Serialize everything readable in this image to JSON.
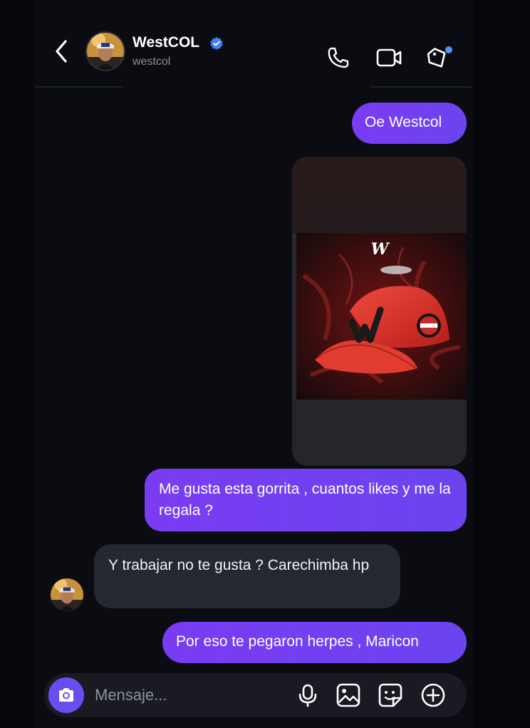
{
  "header": {
    "name": "WestCOL",
    "username": "westcol",
    "verified": true,
    "icons": [
      "back-icon",
      "phone-icon",
      "video-camera-icon",
      "tag-icon"
    ],
    "tag_badge_color": "#5b8ff9"
  },
  "messages": [
    {
      "sender": "me",
      "text": "Oe Westcol"
    },
    {
      "sender": "me",
      "type": "image",
      "image_description_text": "W"
    },
    {
      "sender": "me",
      "text": "Me gusta esta gorrita , cuantos likes y me la regala ?"
    },
    {
      "sender": "westcol",
      "text": "Y trabajar no te gusta ? Carechimba hp"
    },
    {
      "sender": "me",
      "text": "Por eso te pegaron herpes , Maricon"
    }
  ],
  "composer": {
    "placeholder": "Mensaje...",
    "icons": [
      "camera-icon",
      "microphone-icon",
      "gallery-icon",
      "sticker-icon",
      "add-icon"
    ]
  },
  "colors": {
    "background": "#0b0c12",
    "outgoing_bubble": "#7040f0",
    "incoming_bubble": "#262830",
    "camera_button": "#6a4df0"
  }
}
